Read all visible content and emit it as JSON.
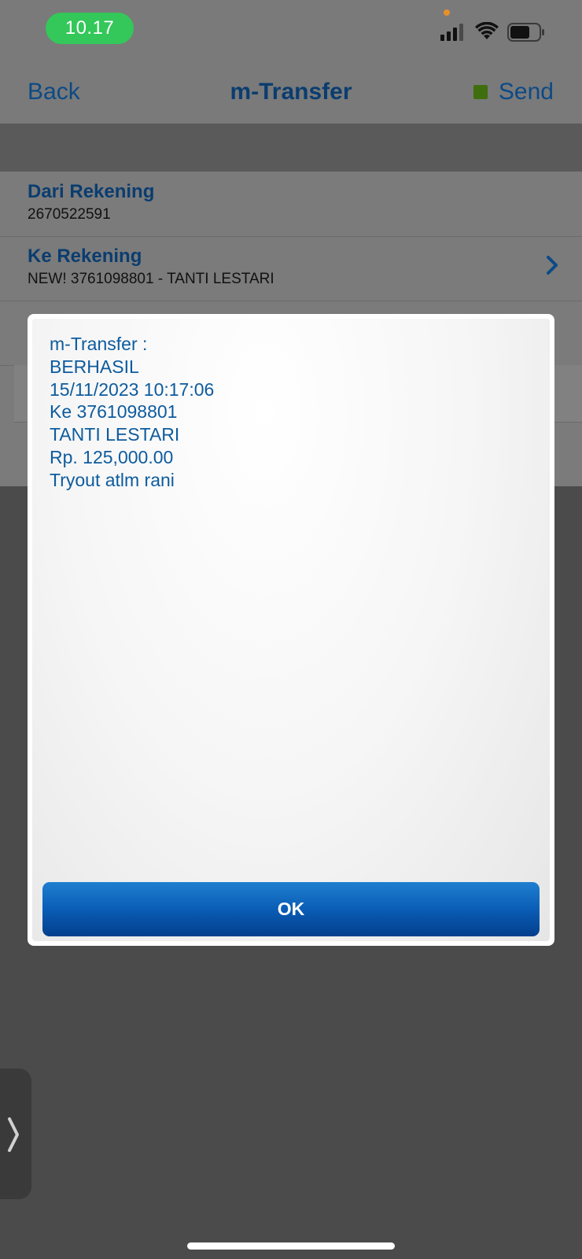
{
  "status_bar": {
    "time": "10.17",
    "icons": [
      "signal-icon",
      "wifi-icon",
      "battery-icon"
    ]
  },
  "nav": {
    "back_label": "Back",
    "title": "m-Transfer",
    "send_label": "Send",
    "send_indicator_color": "#3f6e0e"
  },
  "form": {
    "from_account": {
      "label": "Dari Rekening",
      "value": "2670522591"
    },
    "to_account": {
      "label": "Ke Rekening",
      "value": "NEW! 3761098801 - TANTI LESTARI"
    }
  },
  "modal": {
    "lines": [
      "m-Transfer :",
      "BERHASIL",
      "15/11/2023 10:17:06",
      "Ke 3761098801",
      "TANTI LESTARI",
      "Rp. 125,000.00",
      "Tryout atlm rani"
    ],
    "ok_label": "OK"
  },
  "colors": {
    "accent_blue": "#0c4a86",
    "message_blue": "#0d5b9e",
    "ok_button": "#0a5db5",
    "time_pill": "#34c759"
  }
}
